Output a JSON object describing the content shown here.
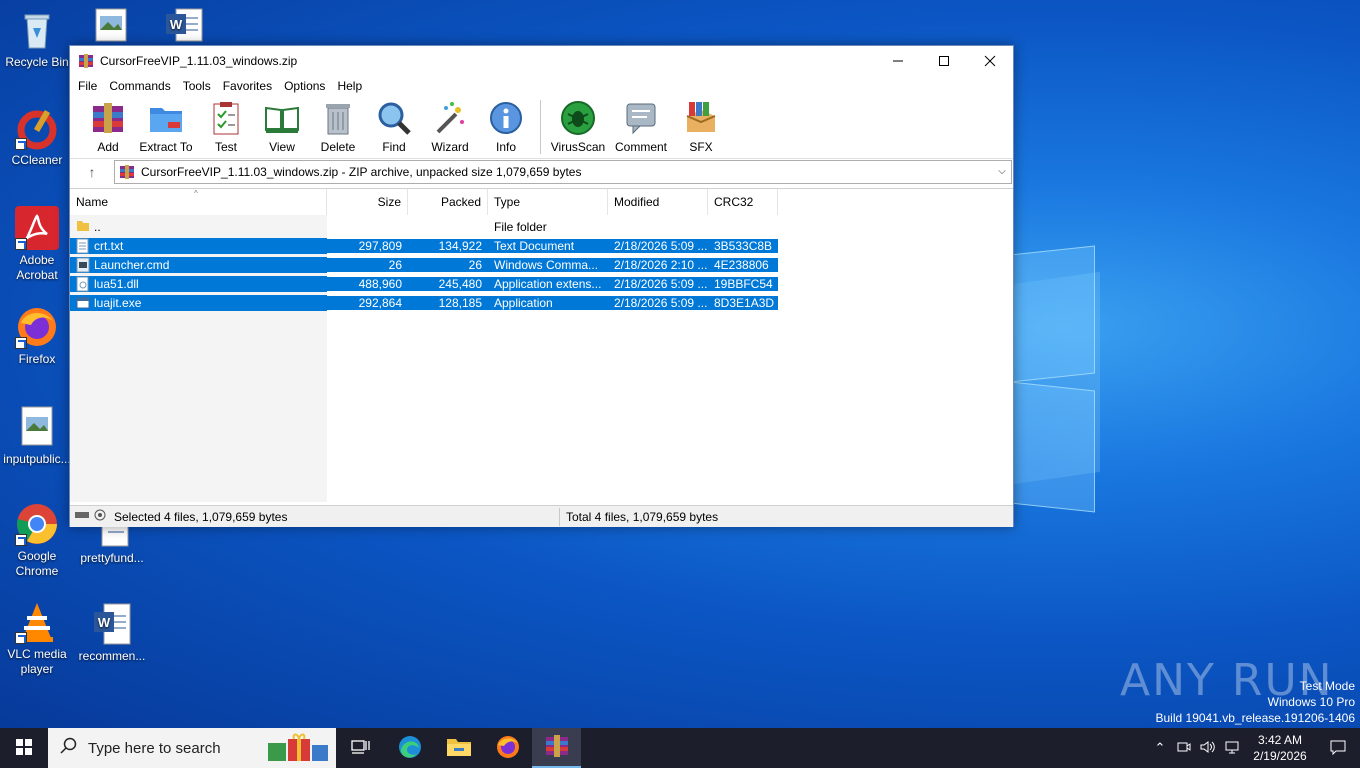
{
  "desktop": {
    "icons": [
      {
        "label": "Recycle Bin"
      },
      {
        "label": "CCleaner"
      },
      {
        "label": "Adobe Acrobat"
      },
      {
        "label": "Firefox"
      },
      {
        "label": "inputpublic..."
      },
      {
        "label": "Google Chrome"
      },
      {
        "label": "VLC media player"
      },
      {
        "label": "prettyfund..."
      },
      {
        "label": "recommen..."
      }
    ],
    "watermark": "ANY RUN",
    "test_mode": [
      "Test Mode",
      "Windows 10 Pro",
      "Build 19041.vb_release.191206-1406"
    ]
  },
  "window": {
    "title": "CursorFreeVIP_1.11.03_windows.zip",
    "menu": [
      "File",
      "Commands",
      "Tools",
      "Favorites",
      "Options",
      "Help"
    ],
    "toolbar": [
      "Add",
      "Extract To",
      "Test",
      "View",
      "Delete",
      "Find",
      "Wizard",
      "Info",
      "VirusScan",
      "Comment",
      "SFX"
    ],
    "path": "CursorFreeVIP_1.11.03_windows.zip - ZIP archive, unpacked size 1,079,659 bytes",
    "columns": [
      "Name",
      "Size",
      "Packed",
      "Type",
      "Modified",
      "CRC32"
    ],
    "rows": [
      {
        "name": "..",
        "size": "",
        "packed": "",
        "type": "File folder",
        "modified": "",
        "crc": "",
        "selected": false,
        "icon": "folder-icon"
      },
      {
        "name": "crt.txt",
        "size": "297,809",
        "packed": "134,922",
        "type": "Text Document",
        "modified": "2/18/2026 5:09 ...",
        "crc": "3B533C8B",
        "selected": true,
        "icon": "text-file-icon"
      },
      {
        "name": "Launcher.cmd",
        "size": "26",
        "packed": "26",
        "type": "Windows Comma...",
        "modified": "2/18/2026 2:10 ...",
        "crc": "4E238806",
        "selected": true,
        "icon": "cmd-file-icon"
      },
      {
        "name": "lua51.dll",
        "size": "488,960",
        "packed": "245,480",
        "type": "Application extens...",
        "modified": "2/18/2026 5:09 ...",
        "crc": "19BBFC54",
        "selected": true,
        "icon": "dll-file-icon"
      },
      {
        "name": "luajit.exe",
        "size": "292,864",
        "packed": "128,185",
        "type": "Application",
        "modified": "2/18/2026 5:09 ...",
        "crc": "8D3E1A3D",
        "selected": true,
        "icon": "exe-file-icon"
      }
    ],
    "status_left": "Selected 4 files, 1,079,659 bytes",
    "status_right": "Total 4 files, 1,079,659 bytes"
  },
  "taskbar": {
    "search_placeholder": "Type here to search",
    "time": "3:42 AM",
    "date": "2/19/2026"
  }
}
